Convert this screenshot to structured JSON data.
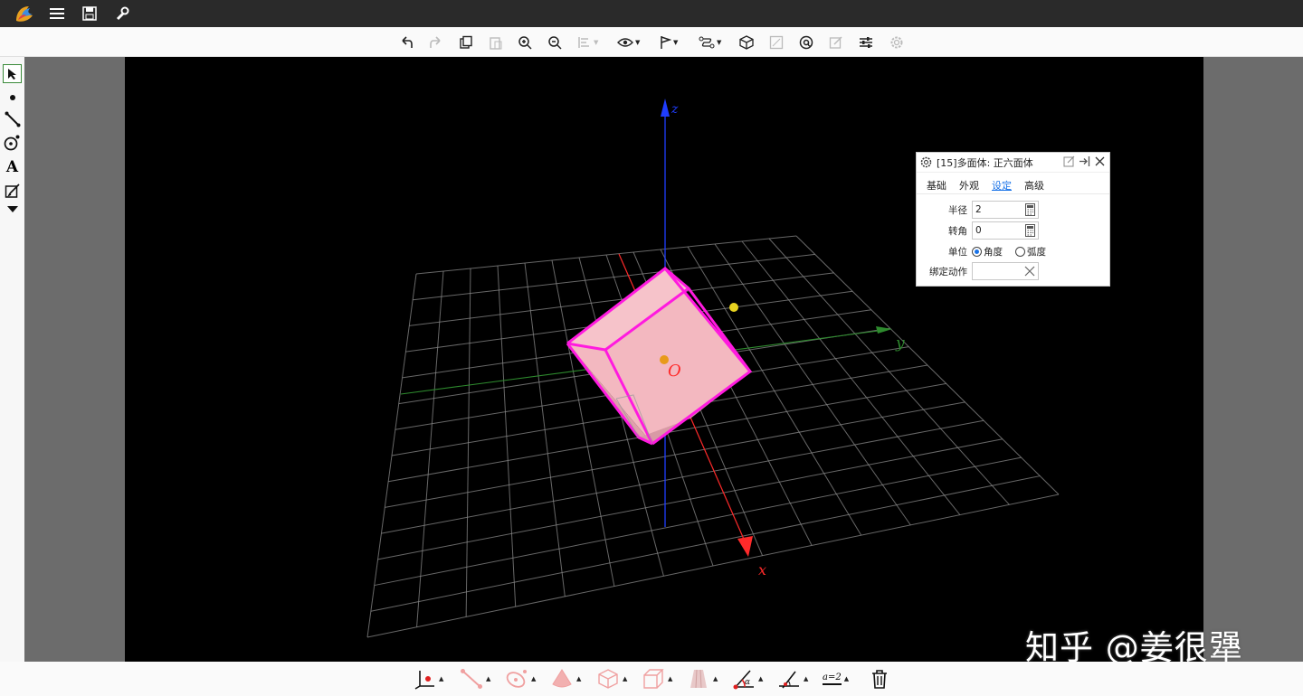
{
  "app": {
    "menu_icons": [
      "logo-icon",
      "menu-icon",
      "save-icon",
      "wrench-icon"
    ]
  },
  "toolbar": {
    "icons": [
      "undo-icon",
      "redo-icon",
      "copy-icon",
      "paste-icon",
      "zoom-in-icon",
      "zoom-out-icon",
      "align-icon",
      "eye-icon",
      "flag-icon",
      "path-icon",
      "cube-view-icon",
      "fullscreen-icon",
      "label-icon",
      "edit-icon",
      "settings-sliders-icon",
      "gear-icon"
    ]
  },
  "left_tools": [
    "select-arrow-icon",
    "point-icon",
    "segment-icon",
    "circle-icon",
    "text-icon",
    "edit-pen-icon",
    "more-down-icon"
  ],
  "scene": {
    "axis_labels": {
      "x": "x",
      "y": "y",
      "z": "z",
      "origin": "O"
    },
    "colors": {
      "x_axis": "#ff2a2a",
      "y_axis": "#2e8b2e",
      "z_axis": "#1f3dff",
      "cube_edge": "#ff1adf",
      "cube_face": "#f3b8c0",
      "grid": "#8a8a8a"
    }
  },
  "panel": {
    "title": "[15]多面体: 正六面体",
    "tabs": [
      "基础",
      "外观",
      "设定",
      "高级"
    ],
    "active_tab": "设定",
    "radius_label": "半径",
    "radius_value": "2",
    "rotation_label": "转角",
    "rotation_value": "0",
    "unit_label": "单位",
    "unit_degree": "角度",
    "unit_radian": "弧度",
    "bind_action_label": "绑定动作"
  },
  "bottom_tools": [
    "point-tool-icon",
    "segment-tool-icon",
    "circle-tool-icon",
    "cone-tool-icon",
    "cube-tool-icon",
    "box-tool-icon",
    "prism-tool-icon",
    "angle-tool-icon",
    "measure-angle-icon",
    "variable-tool-icon",
    "trash-icon"
  ],
  "bottom_variable_label": "a=2",
  "watermark": "知乎 @姜很犟"
}
